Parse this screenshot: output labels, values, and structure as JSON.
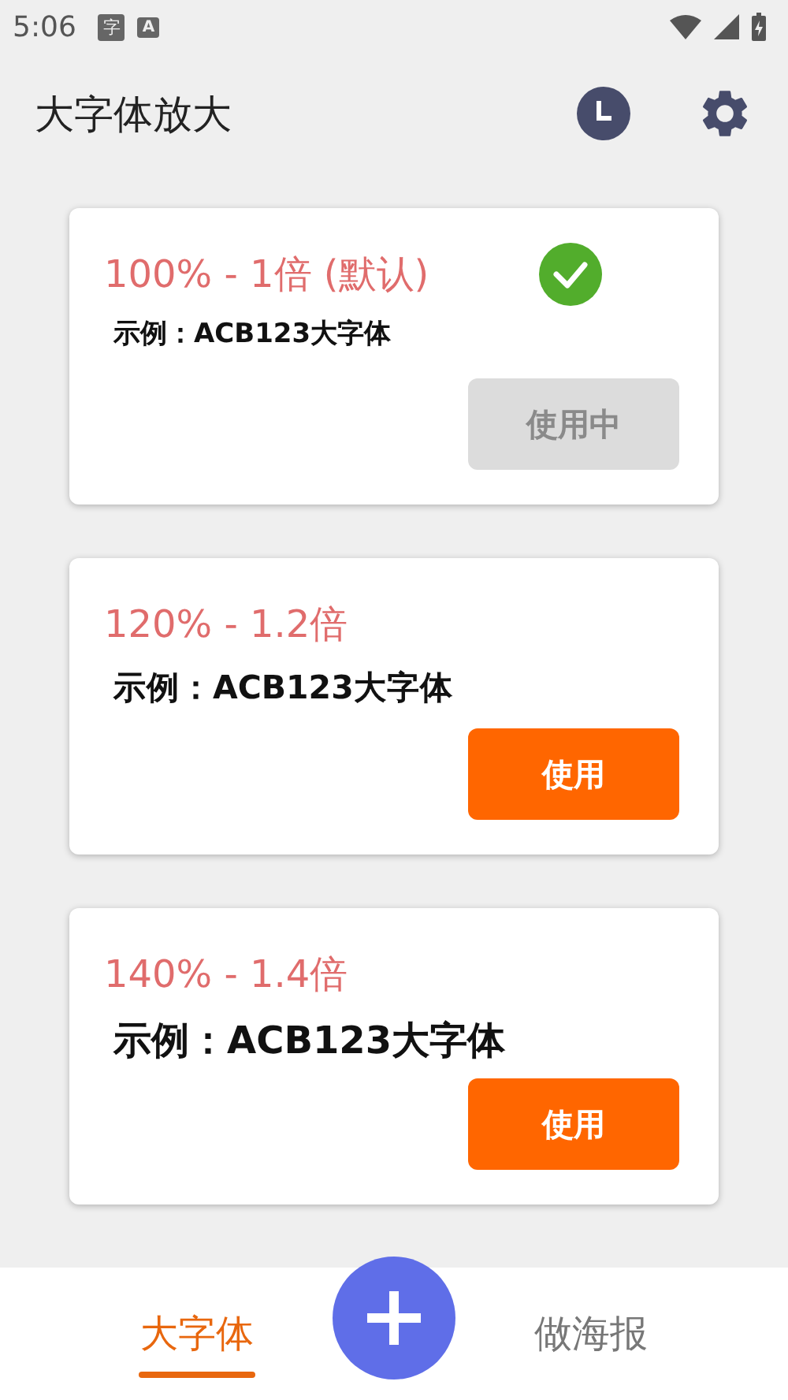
{
  "status_bar": {
    "time": "5:06",
    "notifications": [
      "字",
      "A"
    ]
  },
  "app_bar": {
    "title": "大字体放大"
  },
  "options": [
    {
      "title": "100% - 1倍 (默认)",
      "sample": "示例：ACB123大字体",
      "button": "使用中",
      "selected": true
    },
    {
      "title": "120% - 1.2倍",
      "sample": "示例：ACB123大字体",
      "button": "使用",
      "selected": false
    },
    {
      "title": "140% - 1.4倍",
      "sample": "示例：ACB123大字体",
      "button": "使用",
      "selected": false
    }
  ],
  "bottom_nav": {
    "tabs": [
      {
        "label": "大字体",
        "selected": true
      },
      {
        "label": "做海报",
        "selected": false
      }
    ]
  }
}
